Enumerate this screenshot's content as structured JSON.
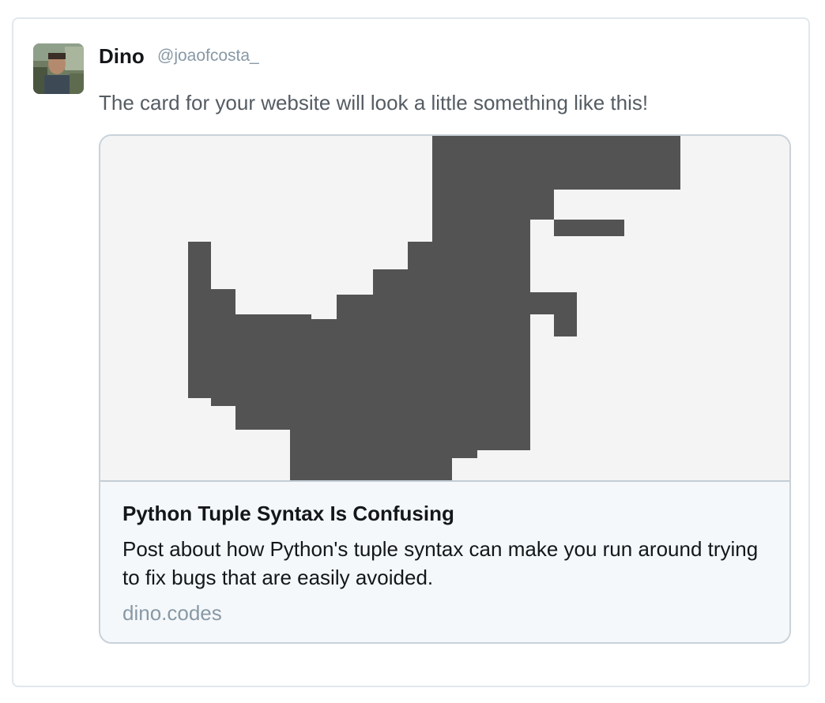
{
  "tweet": {
    "author_name": "Dino",
    "author_handle": "@joaofcosta_",
    "text": "The card for your website will look a little something like this!"
  },
  "card": {
    "title": "Python Tuple Syntax Is Confusing",
    "description": "Post about how Python's tuple syntax can make you run around trying to fix bugs that are easily avoided.",
    "domain": "dino.codes",
    "image_icon": "pixel-dinosaur-icon"
  },
  "colors": {
    "card_background": "#f5f8fa",
    "card_border": "#c9d2da",
    "image_background": "#f4f4f4",
    "dinosaur": "#535353",
    "handle": "#8899a6",
    "tweet_text": "#555c63",
    "title_text": "#14171a"
  }
}
